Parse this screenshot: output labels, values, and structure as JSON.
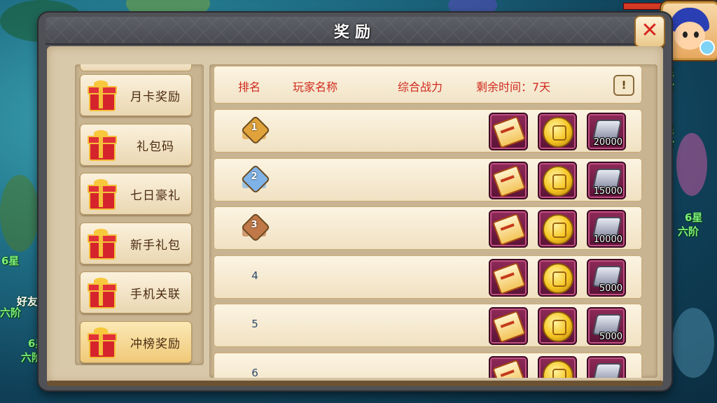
{
  "window": {
    "title": "奖励"
  },
  "sidebar": {
    "items": [
      {
        "label": "月卡奖励",
        "icon": "gift-icon",
        "active": false
      },
      {
        "label": "礼包码",
        "icon": "gift-icon",
        "active": false
      },
      {
        "label": "七日豪礼",
        "icon": "gift-icon",
        "active": false
      },
      {
        "label": "新手礼包",
        "icon": "gift-icon",
        "active": false
      },
      {
        "label": "手机关联",
        "icon": "gift-icon",
        "active": false
      },
      {
        "label": "冲榜奖励",
        "icon": "gift-icon",
        "active": true
      }
    ]
  },
  "ranking": {
    "headers": {
      "rank": "排名",
      "player": "玩家名称",
      "power": "综合战力",
      "time_left": "剩余时间：7天"
    },
    "rows": [
      {
        "rank": "1",
        "medal": "gold",
        "rewards": {
          "scroll": "",
          "coin": "",
          "gem": "20000"
        }
      },
      {
        "rank": "2",
        "medal": "silver",
        "rewards": {
          "scroll": "",
          "coin": "",
          "gem": "15000"
        }
      },
      {
        "rank": "3",
        "medal": "bronze",
        "rewards": {
          "scroll": "",
          "coin": "",
          "gem": "10000"
        }
      },
      {
        "rank": "4",
        "medal": null,
        "rewards": {
          "scroll": "",
          "coin": "",
          "gem": "5000"
        }
      },
      {
        "rank": "5",
        "medal": null,
        "rewards": {
          "scroll": "",
          "coin": "",
          "gem": "5000"
        }
      },
      {
        "rank": "6",
        "medal": null,
        "rewards": {
          "scroll": "",
          "coin": "",
          "gem": ""
        }
      }
    ]
  },
  "background": {
    "labels": [
      "星",
      "阶",
      "星",
      "阶",
      "6星",
      "六阶",
      "6星",
      "六阶",
      "好友",
      "6星",
      "六阶"
    ]
  },
  "colors": {
    "header_text": "#d02a1e",
    "close_x": "#d8261c",
    "medal_gold": "#e0a23a",
    "medal_silver": "#7fb3e8",
    "medal_bronze": "#c07848"
  }
}
